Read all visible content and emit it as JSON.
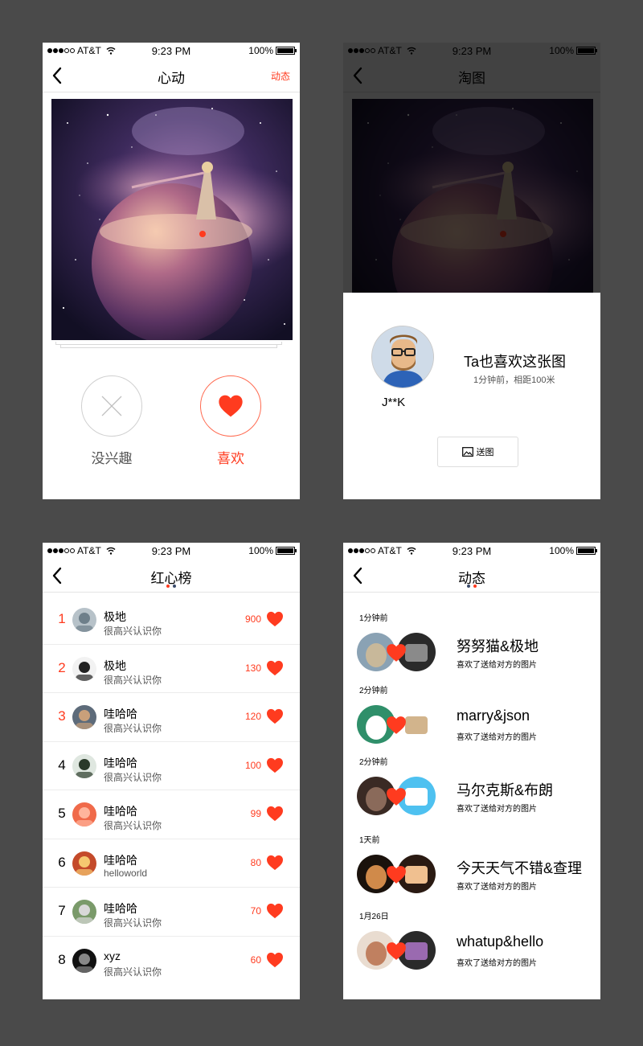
{
  "colors": {
    "accent": "#ff3b1f",
    "background": "#4a4a4a"
  },
  "statusbar": {
    "carrier": "AT&T",
    "time": "9:23 PM",
    "battery": "100%"
  },
  "screen1": {
    "title": "心动",
    "right_link": "动态",
    "dislike_label": "没兴趣",
    "like_label": "喜欢"
  },
  "screen2": {
    "title": "淘图",
    "match_name": "J**K",
    "match_title": "Ta也喜欢这张图",
    "match_sub": "1分钟前，相距100米",
    "send_label": "送图"
  },
  "screen3": {
    "title": "红心榜",
    "rows": [
      {
        "rank": "1",
        "name": "极地",
        "sub": "很高兴认识你",
        "count": "900",
        "highlight": true
      },
      {
        "rank": "2",
        "name": "极地",
        "sub": "很高兴认识你",
        "count": "130",
        "highlight": true
      },
      {
        "rank": "3",
        "name": "哇哈哈",
        "sub": "很高兴认识你",
        "count": "120",
        "highlight": true
      },
      {
        "rank": "4",
        "name": "哇哈哈",
        "sub": "很高兴认识你",
        "count": "100",
        "highlight": false
      },
      {
        "rank": "5",
        "name": "哇哈哈",
        "sub": "很高兴认识你",
        "count": "99",
        "highlight": false
      },
      {
        "rank": "6",
        "name": "哇哈哈",
        "sub": "helloworld",
        "count": "80",
        "highlight": false
      },
      {
        "rank": "7",
        "name": "哇哈哈",
        "sub": "很高兴认识你",
        "count": "70",
        "highlight": false
      },
      {
        "rank": "8",
        "name": "xyz",
        "sub": "很高兴认识你",
        "count": "60",
        "highlight": false
      }
    ]
  },
  "screen4": {
    "title": "动态",
    "items": [
      {
        "time": "1分钟前",
        "title": "努努猫&极地",
        "sub": "喜欢了送给对方的图片"
      },
      {
        "time": "2分钟前",
        "title": "marry&json",
        "sub": "喜欢了送给对方的图片"
      },
      {
        "time": "2分钟前",
        "title": "马尔克斯&布朗",
        "sub": "喜欢了送给对方的图片"
      },
      {
        "time": "1天前",
        "title": "今天天气不错&查理",
        "sub": "喜欢了送给对方的图片"
      },
      {
        "time": "1月26日",
        "title": "whatup&hello",
        "sub": "喜欢了送给对方的图片"
      }
    ]
  }
}
